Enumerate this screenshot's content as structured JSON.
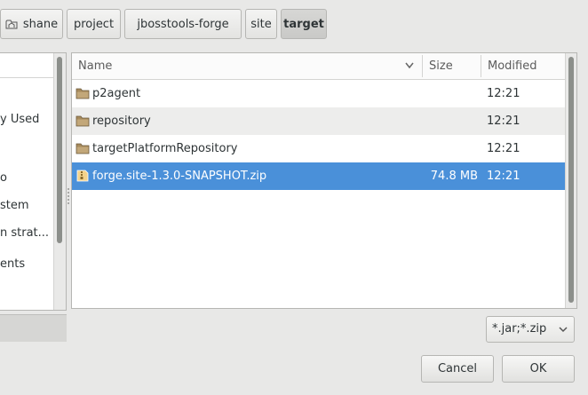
{
  "breadcrumbs": [
    {
      "label": "shane",
      "icon": "home-folder-icon"
    },
    {
      "label": "project"
    },
    {
      "label": "jbosstools-forge"
    },
    {
      "label": "site"
    },
    {
      "label": "target",
      "active": true
    }
  ],
  "sidebar": {
    "items": [
      "y Used",
      "o",
      "stem",
      "n strat...",
      "ents"
    ]
  },
  "file_list": {
    "columns": {
      "name": "Name",
      "size": "Size",
      "modified": "Modified"
    },
    "rows": [
      {
        "name": "p2agent",
        "size": "",
        "modified": "12:21",
        "type": "folder-icon"
      },
      {
        "name": "repository",
        "size": "",
        "modified": "12:21",
        "type": "folder-icon"
      },
      {
        "name": "targetPlatformRepository",
        "size": "",
        "modified": "12:21",
        "type": "folder-icon"
      },
      {
        "name": "forge.site-1.3.0-SNAPSHOT.zip",
        "size": "74.8 MB",
        "modified": "12:21",
        "type": "archive-icon",
        "selected": true
      }
    ]
  },
  "filter": {
    "value": "*.jar;*.zip"
  },
  "buttons": {
    "cancel": "Cancel",
    "ok": "OK"
  },
  "colors": {
    "selection": "#4a90d9",
    "folder": "#b59a6e"
  }
}
